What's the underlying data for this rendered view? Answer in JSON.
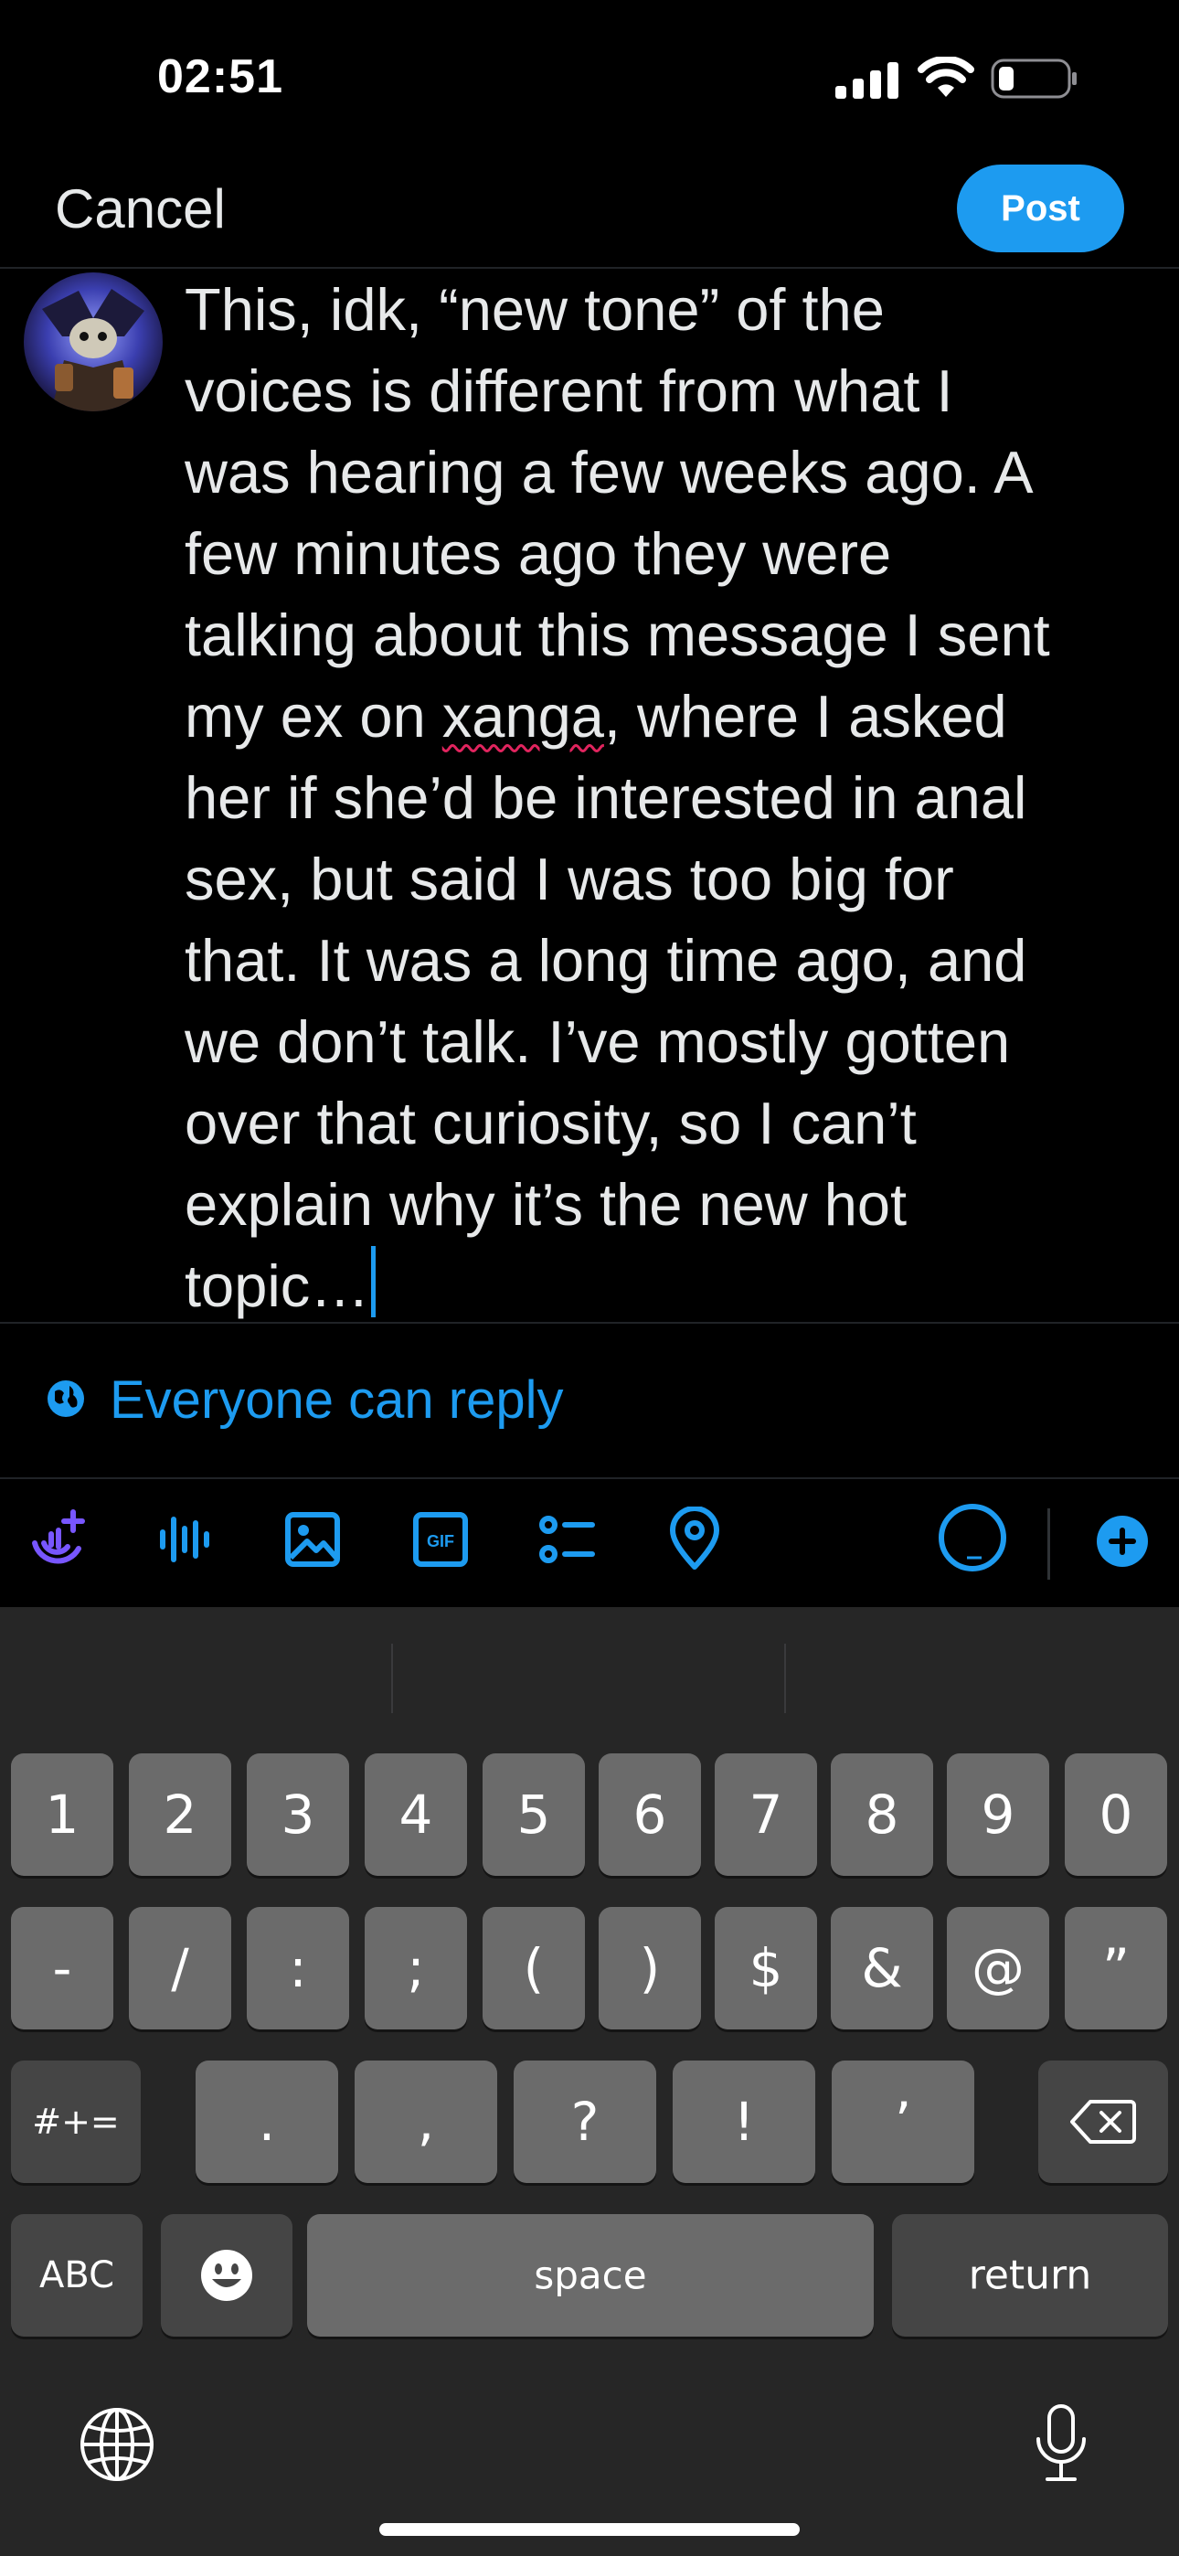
{
  "status": {
    "time": "02:51"
  },
  "header": {
    "cancel_label": "Cancel",
    "post_label": "Post"
  },
  "composer": {
    "text_lines": [
      "This, idk, “new tone” of the",
      "voices is different from what I",
      "was hearing a few weeks ago. A",
      "few minutes ago they were",
      "talking about this message I sent",
      "my ex on ",
      "her if she’d be interested in anal",
      "sex, but said I was too big for",
      "that. It was a long time ago, and",
      "we don’t talk. I’ve mostly gotten",
      "over that curiosity, so I can’t",
      "explain why it’s the new hot",
      "topic…"
    ],
    "misspelled_word": "xanga",
    "line6_rest": ", where I asked"
  },
  "reply_setting": {
    "label": "Everyone can reply"
  },
  "toolbar": {
    "icons": [
      "spaces-icon",
      "voice-icon",
      "image-icon",
      "gif-icon",
      "poll-icon",
      "location-icon"
    ],
    "gif_text": "GIF",
    "accent": "#1d9bf0"
  },
  "keyboard": {
    "row1": [
      "1",
      "2",
      "3",
      "4",
      "5",
      "6",
      "7",
      "8",
      "9",
      "0"
    ],
    "row2": [
      "-",
      "/",
      ":",
      ";",
      "(",
      ")",
      "$",
      "&",
      "@",
      "”"
    ],
    "row3_mode": "#+=",
    "row3": [
      ".",
      ",",
      "?",
      "!",
      "’"
    ],
    "abc": "ABC",
    "space": "space",
    "return": "return"
  }
}
